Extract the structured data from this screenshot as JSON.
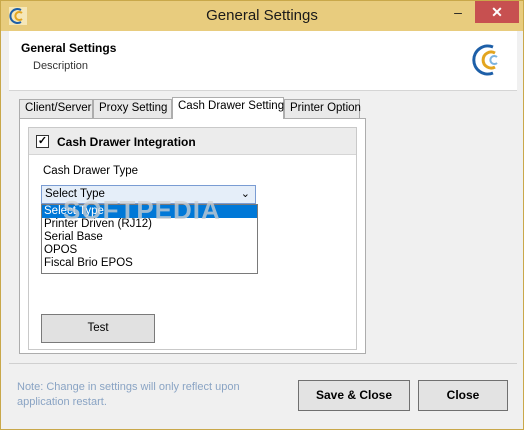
{
  "window": {
    "title": "General Settings",
    "minimize_label": "–",
    "close_label": "✕"
  },
  "header": {
    "title": "General Settings",
    "description": "Description"
  },
  "tabs": [
    {
      "label": "Client/Server",
      "active": false
    },
    {
      "label": "Proxy Setting",
      "active": false
    },
    {
      "label": "Cash Drawer Setting",
      "active": true
    },
    {
      "label": "Printer Option",
      "active": false
    }
  ],
  "cash_drawer": {
    "integration_label": "Cash Drawer Integration",
    "integration_checked": true,
    "checkmark": "✓",
    "type_label": "Cash Drawer Type",
    "selected": "Select Type",
    "dropdown_arrow": "⌄",
    "options": [
      "Select Type",
      "Printer Driven (RJ12)",
      "Serial Base",
      "OPOS",
      "Fiscal Brio EPOS"
    ],
    "test_label": "Test"
  },
  "watermark": "SOFTPEDIA",
  "footer": {
    "note": "Note: Change in settings will only reflect upon application restart.",
    "save_label": "Save & Close",
    "close_label": "Close"
  },
  "colors": {
    "title_bar": "#e8cc7e",
    "selection": "#0078d7",
    "close_button": "#c75050",
    "note_text": "#8aa4c4"
  }
}
